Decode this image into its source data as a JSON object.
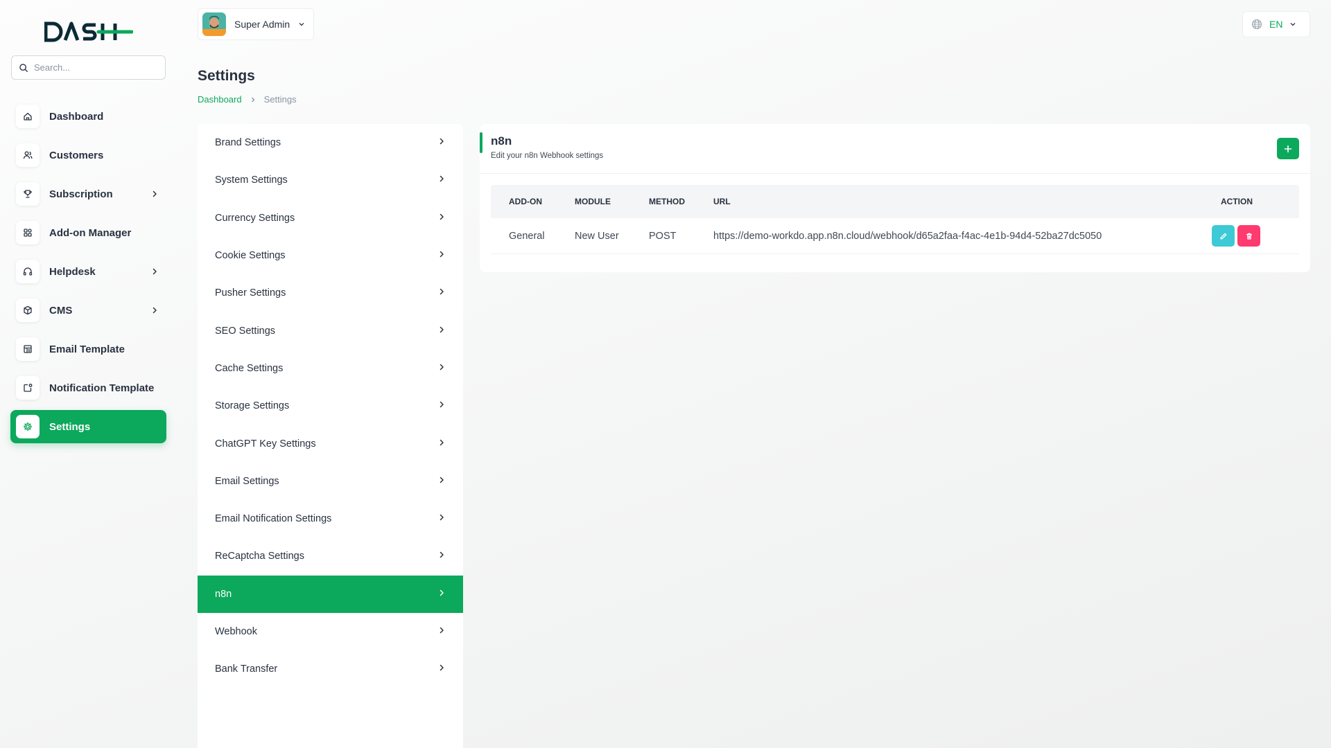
{
  "brand": {
    "logo_text": "DASH",
    "accent_color": "#0ca85c"
  },
  "search": {
    "placeholder": "Search..."
  },
  "sidebar": {
    "items": [
      {
        "label": "Dashboard",
        "icon": "home-icon",
        "has_children": false,
        "active": false
      },
      {
        "label": "Customers",
        "icon": "users-icon",
        "has_children": false,
        "active": false
      },
      {
        "label": "Subscription",
        "icon": "trophy-icon",
        "has_children": true,
        "active": false
      },
      {
        "label": "Add-on Manager",
        "icon": "grid-icon",
        "has_children": false,
        "active": false
      },
      {
        "label": "Helpdesk",
        "icon": "headphones-icon",
        "has_children": true,
        "active": false
      },
      {
        "label": "CMS",
        "icon": "box-icon",
        "has_children": true,
        "active": false
      },
      {
        "label": "Email Template",
        "icon": "template-icon",
        "has_children": false,
        "active": false
      },
      {
        "label": "Notification Template",
        "icon": "notification-icon",
        "has_children": false,
        "active": false
      },
      {
        "label": "Settings",
        "icon": "gear-icon",
        "has_children": false,
        "active": true
      }
    ]
  },
  "header": {
    "user_name": "Super Admin",
    "language": "EN"
  },
  "page": {
    "title": "Settings",
    "breadcrumb": {
      "home": "Dashboard",
      "current": "Settings"
    }
  },
  "settings_menu": {
    "items": [
      "Brand Settings",
      "System Settings",
      "Currency Settings",
      "Cookie Settings",
      "Pusher Settings",
      "SEO Settings",
      "Cache Settings",
      "Storage Settings",
      "ChatGPT Key Settings",
      "Email Settings",
      "Email Notification Settings",
      "ReCaptcha Settings",
      "n8n",
      "Webhook",
      "Bank Transfer"
    ],
    "active_index": 12
  },
  "card": {
    "title": "n8n",
    "subtitle": "Edit your n8n Webhook settings",
    "add_label": "+",
    "columns": {
      "addon": "ADD-ON",
      "module": "MODULE",
      "method": "METHOD",
      "url": "URL",
      "action": "ACTION"
    },
    "rows": [
      {
        "addon": "General",
        "module": "New User",
        "method": "POST",
        "url": "https://demo-workdo.app.n8n.cloud/webhook/d65a2faa-f4ac-4e1b-94d4-52ba27dc5050"
      }
    ],
    "action_colors": {
      "edit": "#3ec9d6",
      "delete": "#ff3a6e"
    }
  }
}
